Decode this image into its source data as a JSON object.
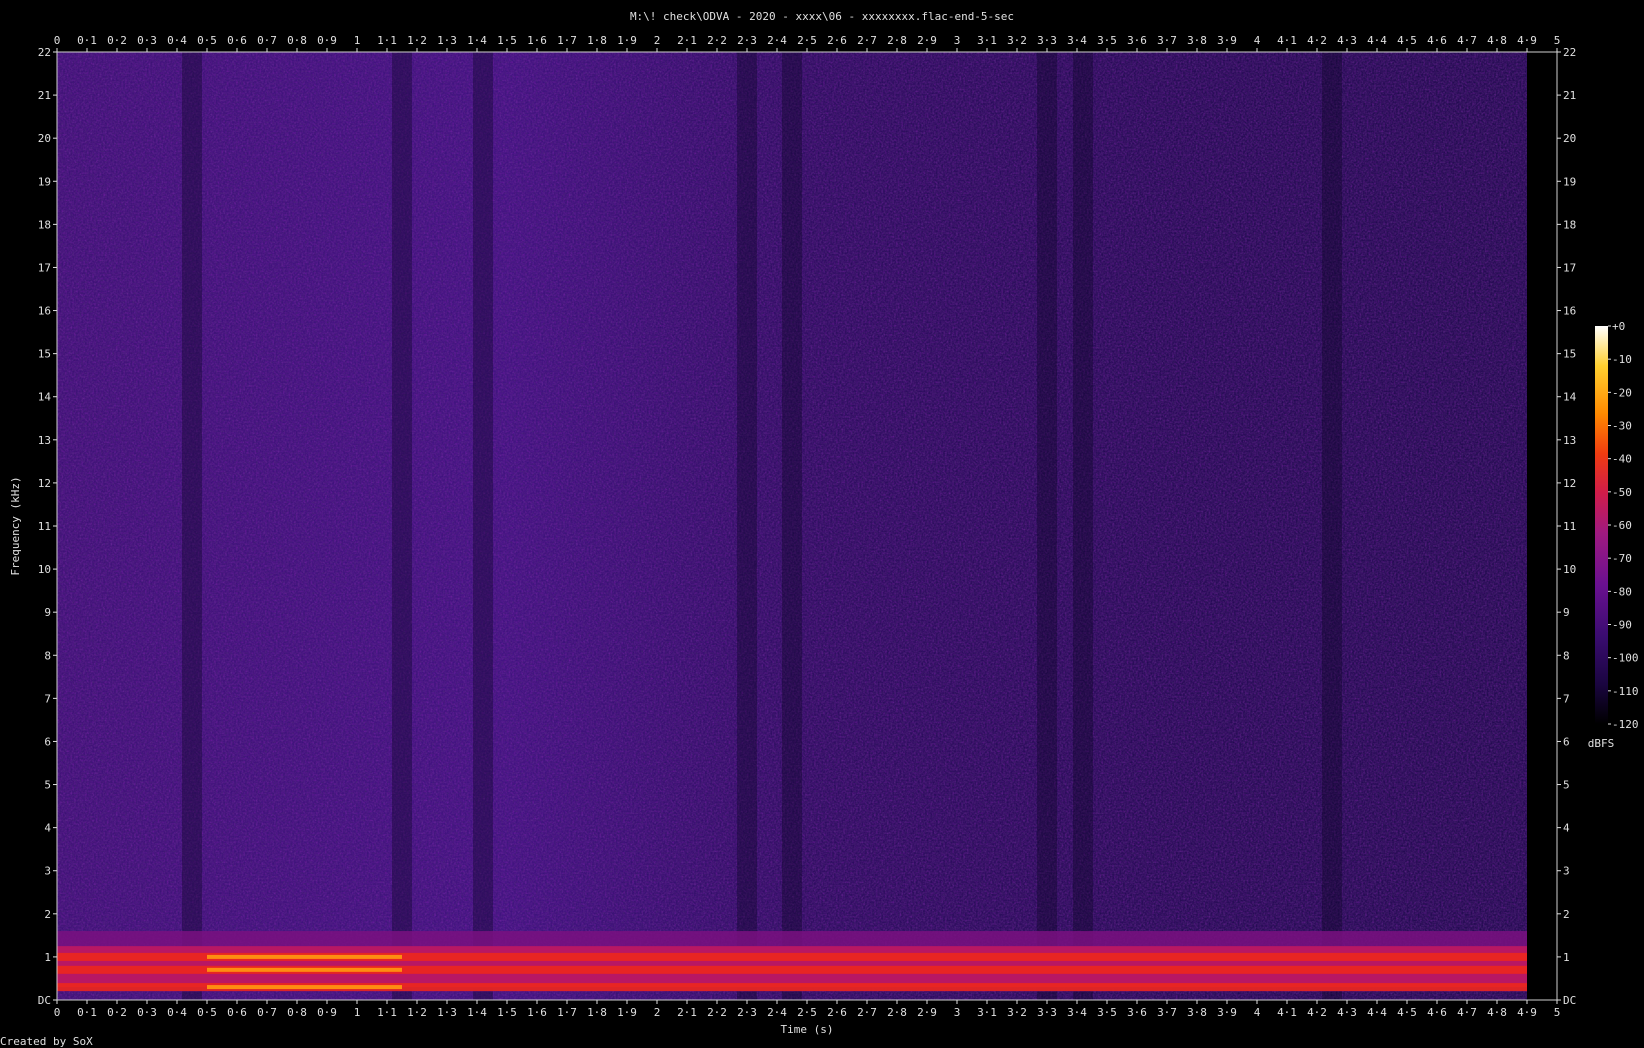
{
  "title": "M:\\! check\\ODVA - 2020 - xxxx\\06 - xxxxxxxx.flac-end-5-sec",
  "footer": "Created by SoX",
  "chart_data": {
    "type": "heatmap",
    "title": "M:\\! check\\ODVA - 2020 - xxxx\\06 - xxxxxxxx.flac-end-5-sec",
    "xlabel": "Time (s)",
    "ylabel": "Frequency (kHz)",
    "xlim": [
      0,
      5
    ],
    "ylim": [
      0,
      22
    ],
    "x_ticks": [
      "0",
      "0·1",
      "0·2",
      "0·3",
      "0·4",
      "0·5",
      "0·6",
      "0·7",
      "0·8",
      "0·9",
      "1",
      "1·1",
      "1·2",
      "1·3",
      "1·4",
      "1·5",
      "1·6",
      "1·7",
      "1·8",
      "1·9",
      "2",
      "2·1",
      "2·2",
      "2·3",
      "2·4",
      "2·5",
      "2·6",
      "2·7",
      "2·8",
      "2·9",
      "3",
      "3·1",
      "3·2",
      "3·3",
      "3·4",
      "3·5",
      "3·6",
      "3·7",
      "3·8",
      "3·9",
      "4",
      "4·1",
      "4·2",
      "4·3",
      "4·4",
      "4·5",
      "4·6",
      "4·7",
      "4·8",
      "4·9",
      "5"
    ],
    "y_ticks": [
      "DC",
      "1",
      "2",
      "3",
      "4",
      "5",
      "6",
      "7",
      "8",
      "9",
      "10",
      "11",
      "12",
      "13",
      "14",
      "15",
      "16",
      "17",
      "18",
      "19",
      "20",
      "21",
      "22"
    ],
    "colorbar": {
      "label": "dBFS",
      "range": [
        -120,
        0
      ],
      "ticks": [
        "+0",
        "-10",
        "-20",
        "-30",
        "-40",
        "-50",
        "-60",
        "-70",
        "-80",
        "-90",
        "-100",
        "-110",
        "-120"
      ],
      "colors": [
        "#000000",
        "#1a0540",
        "#3a0c70",
        "#6a1090",
        "#a01a80",
        "#d01c4a",
        "#f03c10",
        "#ff8a00",
        "#ffd030",
        "#ffffff"
      ]
    },
    "signal_end_s": 4.9,
    "bands_khz": [
      0.3,
      0.7,
      1.0
    ],
    "grid": false
  }
}
